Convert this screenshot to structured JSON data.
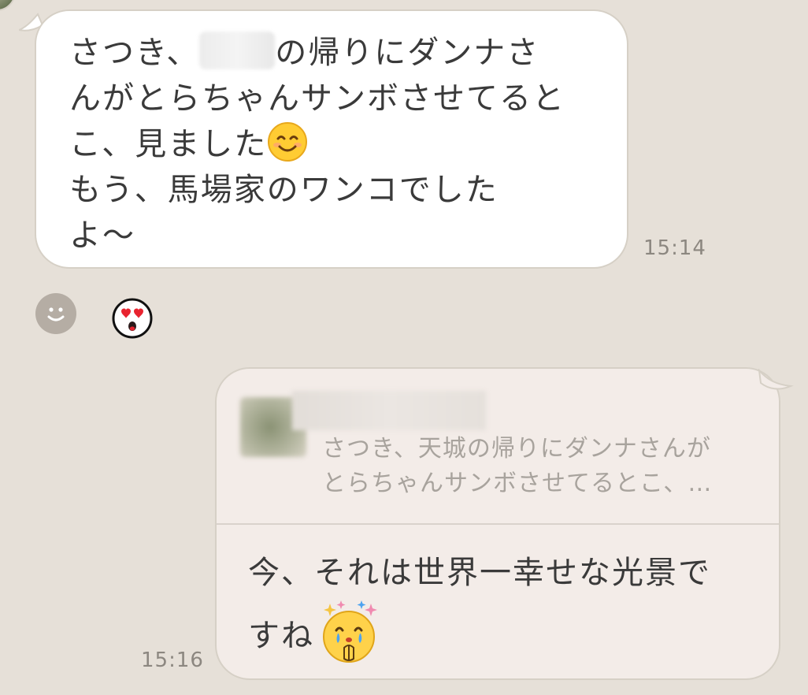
{
  "incoming": {
    "line1_before": "さつき、",
    "line1_after": "の帰りにダンナさ",
    "line2": "んがとらちゃんサンボさせてると",
    "line3": "こ、見ました",
    "line4": "もう、馬場家のワンコでした",
    "line5": "よ〜",
    "emoji": "smiling-face-icon",
    "time": "15:14"
  },
  "reactions": {
    "add_icon": "smile-outline-icon",
    "heart_icon": "heart-eyes-face-icon"
  },
  "outgoing": {
    "reply_line1": "さつき、天城の帰りにダンナさんが",
    "reply_line2": "とらちゃんサンボさせてるとこ、…",
    "line1": "今、それは世界一幸せな光景で",
    "line2": "すね",
    "emoji": "crying-praying-face-icon",
    "time": "15:16"
  },
  "colors": {
    "background": "#e6e0d8",
    "incoming_bubble": "#ffffff",
    "outgoing_bubble": "#f3ece8",
    "text": "#3a3a3a",
    "time": "#8c8780",
    "reply_text": "#a8a39d"
  }
}
